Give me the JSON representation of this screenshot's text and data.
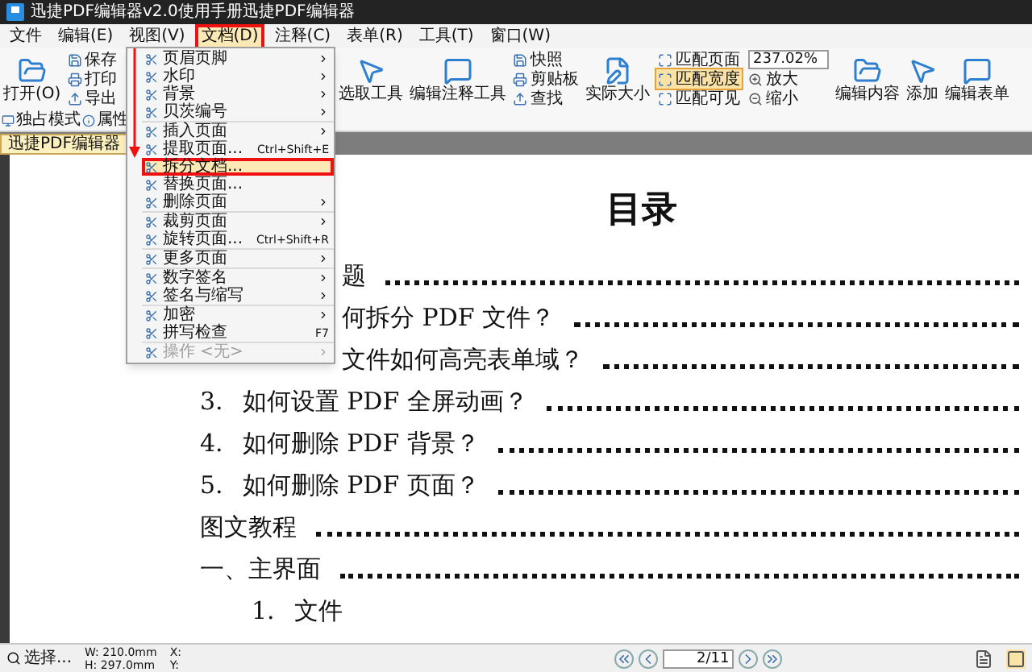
{
  "window": {
    "title": "迅捷PDF编辑器v2.0使用手册迅捷PDF编辑器"
  },
  "menu_bar": [
    {
      "label": "文件",
      "selected": false
    },
    {
      "label": "编辑(E)",
      "selected": false
    },
    {
      "label": "视图(V)",
      "selected": false
    },
    {
      "label": "文档(D)",
      "selected": true
    },
    {
      "label": "注释(C)",
      "selected": false
    },
    {
      "label": "表单(R)",
      "selected": false
    },
    {
      "label": "工具(T)",
      "selected": false
    },
    {
      "label": "窗口(W)",
      "selected": false
    }
  ],
  "toolbar": {
    "left": [
      {
        "kind": "large",
        "label": "打开(O)"
      },
      {
        "kind": "stack",
        "labels": [
          "保存",
          "打印",
          "导出"
        ]
      }
    ],
    "right": [
      {
        "kind": "large",
        "label": "选取工具"
      },
      {
        "kind": "large",
        "label": "编辑注释工具"
      },
      {
        "kind": "stack",
        "labels": [
          "快照",
          "剪贴板",
          "查找"
        ]
      },
      {
        "kind": "large",
        "label": "实际大小"
      },
      {
        "kind": "toggles",
        "items": [
          {
            "label": "匹配页面",
            "selected": false
          },
          {
            "label": "匹配宽度",
            "selected": true
          },
          {
            "label": "匹配可见",
            "selected": false
          }
        ]
      },
      {
        "kind": "zoom",
        "value": "237.02%",
        "labels": [
          "放大",
          "缩小"
        ]
      },
      {
        "kind": "large",
        "label": "编辑内容"
      },
      {
        "kind": "large",
        "label": "添加"
      },
      {
        "kind": "large",
        "label": "编辑表单"
      }
    ]
  },
  "second_row": [
    "独占模式",
    "属性"
  ],
  "document_tab": {
    "label": "迅捷PDF编辑器"
  },
  "document": {
    "heading": "目录",
    "lines": [
      {
        "kind": "partial",
        "text": "题"
      },
      {
        "kind": "partial",
        "text": "何拆分 PDF 文件？"
      },
      {
        "kind": "partial",
        "text": "文件如何高亮表单域？"
      },
      {
        "kind": "entry",
        "number": "3.",
        "text": "如何设置 PDF 全屏动画？"
      },
      {
        "kind": "entry",
        "number": "4.",
        "text": "如何删除 PDF 背景？"
      },
      {
        "kind": "entry",
        "number": "5.",
        "text": "如何删除 PDF 页面？"
      },
      {
        "kind": "entry",
        "text": "图文教程"
      },
      {
        "kind": "entry",
        "text": "一、主界面"
      },
      {
        "kind": "sub",
        "number": "1.",
        "text": "文件"
      }
    ]
  },
  "dropdown": {
    "groups": [
      [
        {
          "label": "页眉页脚",
          "submenu": true,
          "selected": false,
          "disabled": false
        },
        {
          "label": "水印",
          "submenu": true,
          "selected": false,
          "disabled": false
        },
        {
          "label": "背景",
          "submenu": true,
          "selected": false,
          "disabled": false
        },
        {
          "label": "贝茨编号",
          "submenu": true,
          "selected": false,
          "disabled": false
        }
      ],
      [
        {
          "label": "插入页面",
          "submenu": true,
          "selected": false,
          "disabled": false
        },
        {
          "label": "提取页面...",
          "shortcut": "Ctrl+Shift+E",
          "submenu": false,
          "selected": false,
          "disabled": false
        },
        {
          "label": "拆分文档...",
          "submenu": false,
          "selected": true,
          "disabled": false
        },
        {
          "label": "替换页面...",
          "submenu": false,
          "selected": false,
          "disabled": false
        },
        {
          "label": "删除页面",
          "submenu": true,
          "selected": false,
          "disabled": false
        }
      ],
      [
        {
          "label": "裁剪页面",
          "submenu": true,
          "selected": false,
          "disabled": false
        },
        {
          "label": "旋转页面...",
          "shortcut": "Ctrl+Shift+R",
          "submenu": false,
          "selected": false,
          "disabled": false
        }
      ],
      [
        {
          "label": "更多页面",
          "submenu": true,
          "selected": false,
          "disabled": false
        }
      ],
      [
        {
          "label": "数字签名",
          "submenu": true,
          "selected": false,
          "disabled": false
        },
        {
          "label": "签名与缩写",
          "submenu": true,
          "selected": false,
          "disabled": false
        }
      ],
      [
        {
          "label": "加密",
          "submenu": true,
          "selected": false,
          "disabled": false
        },
        {
          "label": "拼写检查",
          "shortcut": "F7",
          "submenu": false,
          "selected": false,
          "disabled": false
        }
      ],
      [
        {
          "label": "操作 <无>",
          "submenu": true,
          "selected": false,
          "disabled": true
        }
      ]
    ]
  },
  "status_bar": {
    "tool": "选择...",
    "width": "W: 210.0mm",
    "height": "H: 297.0mm",
    "x": "X:",
    "y": "Y:",
    "page": "2/11"
  }
}
